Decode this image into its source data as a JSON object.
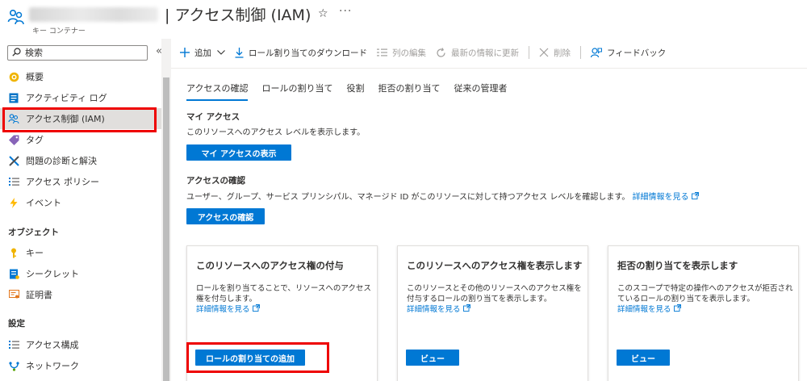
{
  "header": {
    "title": "| アクセス制御 (IAM)",
    "subtitle": "キー コンテナー",
    "star_icon": "star-icon",
    "more": "···"
  },
  "sidebar": {
    "search_placeholder": "検索",
    "collapse": "«",
    "items": [
      {
        "label": "概要",
        "icon": "overview-icon"
      },
      {
        "label": "アクティビティ ログ",
        "icon": "activity-log-icon"
      },
      {
        "label": "アクセス制御 (IAM)",
        "icon": "iam-icon",
        "active": true
      },
      {
        "label": "タグ",
        "icon": "tag-icon"
      },
      {
        "label": "問題の診断と解決",
        "icon": "diagnose-icon"
      },
      {
        "label": "アクセス ポリシー",
        "icon": "access-policy-icon"
      },
      {
        "label": "イベント",
        "icon": "event-icon"
      }
    ],
    "section_objects": "オブジェクト",
    "object_items": [
      {
        "label": "キー",
        "icon": "key-icon"
      },
      {
        "label": "シークレット",
        "icon": "secret-icon"
      },
      {
        "label": "証明書",
        "icon": "certificate-icon"
      }
    ],
    "section_settings": "設定",
    "settings_items": [
      {
        "label": "アクセス構成",
        "icon": "access-config-icon"
      },
      {
        "label": "ネットワーク",
        "icon": "network-icon"
      }
    ]
  },
  "toolbar": {
    "add": "追加",
    "download": "ロール割り当てのダウンロード",
    "edit_columns": "列の編集",
    "refresh": "最新の情報に更新",
    "delete": "削除",
    "feedback": "フィードバック"
  },
  "tabs": [
    "アクセスの確認",
    "ロールの割り当て",
    "役割",
    "拒否の割り当て",
    "従来の管理者"
  ],
  "my_access": {
    "title": "マイ アクセス",
    "desc": "このリソースへのアクセス レベルを表示します。",
    "button": "マイ アクセスの表示"
  },
  "check_access": {
    "title": "アクセスの確認",
    "desc": "ユーザー、グループ、サービス プリンシパル、マネージド ID がこのリソースに対して持つアクセス レベルを確認します。",
    "link": "詳細情報を見る",
    "button": "アクセスの確認"
  },
  "cards": [
    {
      "title": "このリソースへのアクセス権の付与",
      "desc": "ロールを割り当てることで、リソースへのアクセス権を付与します。",
      "link": "詳細情報を見る",
      "button": "ロールの割り当ての追加"
    },
    {
      "title": "このリソースへのアクセス権を表示します",
      "desc": "このリソースとその他のリソースへのアクセス権を付与するロールの割り当てを表示します。",
      "link": "詳細情報を見る",
      "button": "ビュー"
    },
    {
      "title": "拒否の割り当てを表示します",
      "desc": "このスコープで特定の操作へのアクセスが拒否されているロールの割り当てを表示します。",
      "link": "詳細情報を見る",
      "button": "ビュー"
    }
  ],
  "colors": {
    "accent": "#0078d4",
    "highlight": "#ee0000",
    "active_bg": "#e1dfdd"
  }
}
